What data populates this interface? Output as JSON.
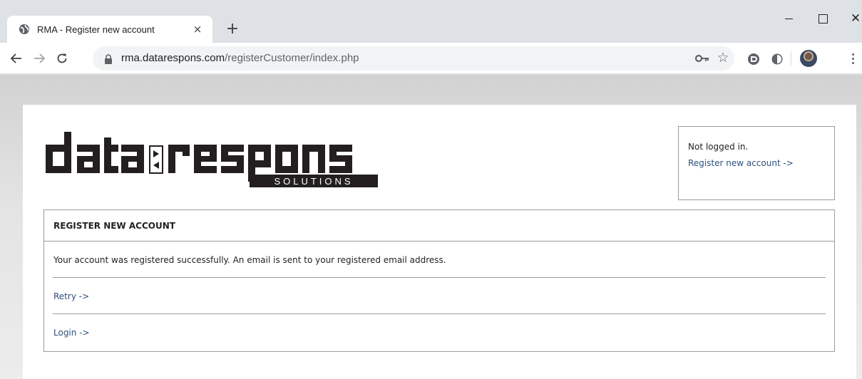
{
  "browser": {
    "tab_title": "RMA - Register new account",
    "tab_close": "×",
    "new_tab": "+",
    "window_close": "✕",
    "url_host": "rma.datarespons.com",
    "url_path": "/registerCustomer/index.php",
    "star": "☆"
  },
  "logo": {
    "text_main": "data",
    "text_second": "respons",
    "tagline": "SOLUTIONS"
  },
  "login_box": {
    "status": "Not logged in.",
    "register_link": "Register new account ->"
  },
  "panel": {
    "title": "REGISTER NEW ACCOUNT",
    "message": "Your account was registered successfully. An email is sent to your registered email address.",
    "retry_link": "Retry ->",
    "login_link": "Login ->"
  },
  "colors": {
    "link": "#2f4f7a",
    "border": "#9a9a9a",
    "logo_dark": "#231f20"
  }
}
